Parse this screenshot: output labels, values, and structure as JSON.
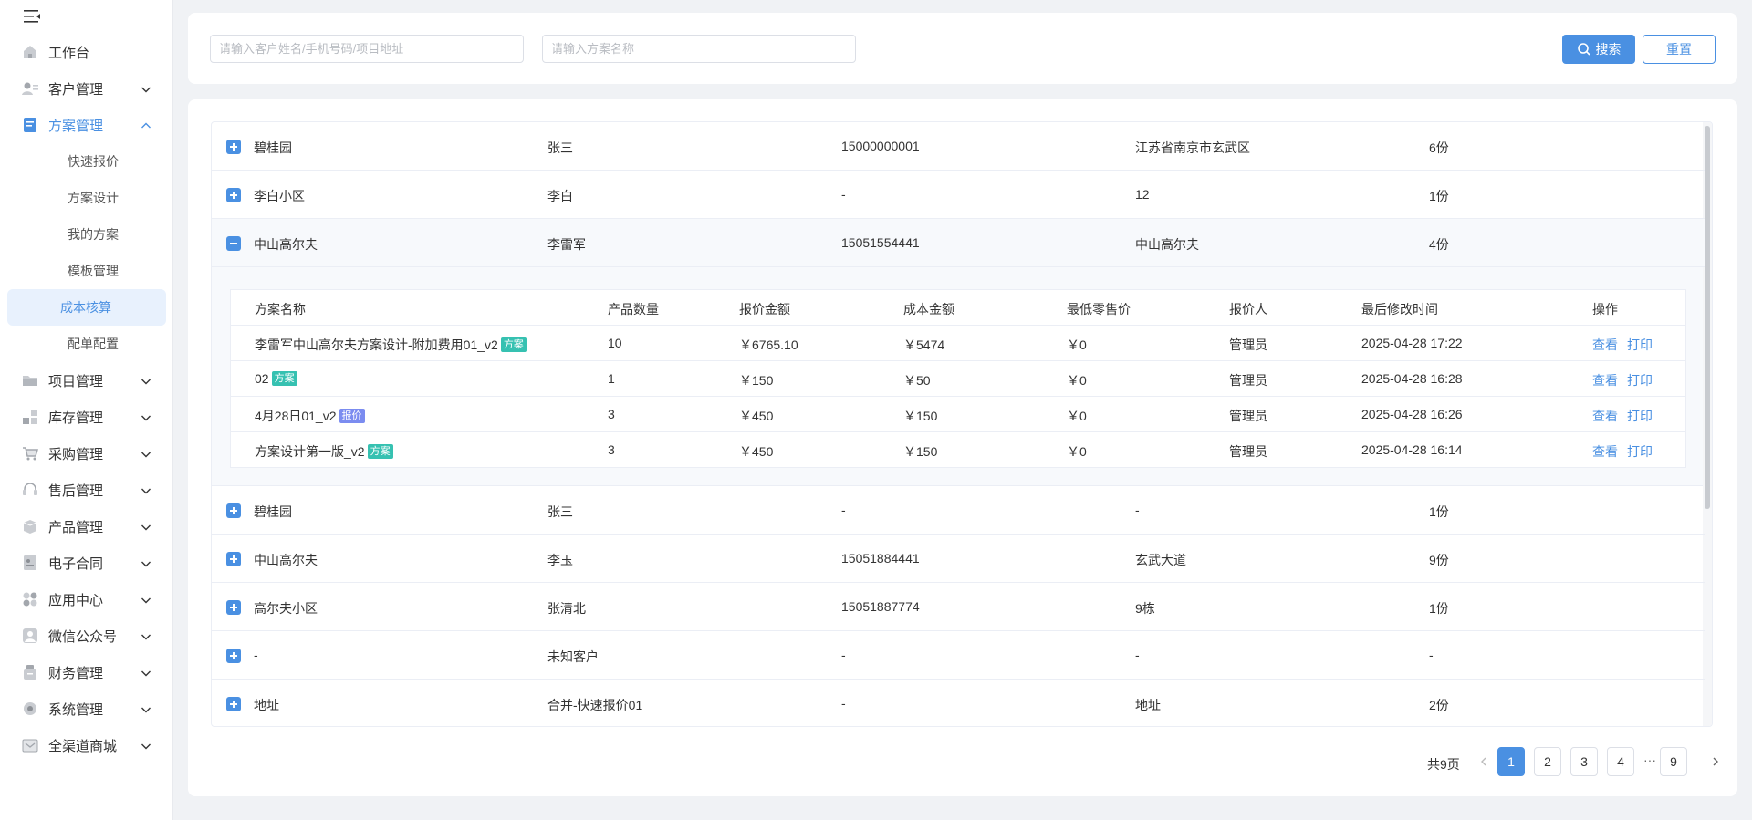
{
  "sidebar": {
    "items": [
      {
        "label": "工作台",
        "icon": "home-icon",
        "has_children": false
      },
      {
        "label": "客户管理",
        "icon": "customer-icon",
        "has_children": true
      },
      {
        "label": "方案管理",
        "icon": "plan-icon",
        "has_children": true,
        "expanded": true,
        "children": [
          "快速报价",
          "方案设计",
          "我的方案",
          "模板管理",
          "成本核算",
          "配单配置"
        ],
        "selected_child": "成本核算"
      },
      {
        "label": "项目管理",
        "icon": "folder-icon",
        "has_children": true
      },
      {
        "label": "库存管理",
        "icon": "inventory-icon",
        "has_children": true
      },
      {
        "label": "采购管理",
        "icon": "cart-icon",
        "has_children": true
      },
      {
        "label": "售后管理",
        "icon": "headset-icon",
        "has_children": true
      },
      {
        "label": "产品管理",
        "icon": "product-icon",
        "has_children": true
      },
      {
        "label": "电子合同",
        "icon": "contract-icon",
        "has_children": true
      },
      {
        "label": "应用中心",
        "icon": "apps-icon",
        "has_children": true
      },
      {
        "label": "微信公众号",
        "icon": "wechat-user-icon",
        "has_children": true
      },
      {
        "label": "财务管理",
        "icon": "finance-icon",
        "has_children": true
      },
      {
        "label": "系统管理",
        "icon": "settings-icon",
        "has_children": true
      },
      {
        "label": "全渠道商城",
        "icon": "mall-icon",
        "has_children": true
      }
    ]
  },
  "search": {
    "customer_placeholder": "请输入客户姓名/手机号码/项目地址",
    "plan_placeholder": "请输入方案名称",
    "search_label": "搜索",
    "reset_label": "重置"
  },
  "rows_top": [
    {
      "project": "碧桂园",
      "customer": "张三",
      "phone": "15000000001",
      "address": "江苏省南京市玄武区",
      "count": "6份"
    },
    {
      "project": "李白小区",
      "customer": "李白",
      "phone": "-",
      "address": "12",
      "count": "1份"
    },
    {
      "project": "中山高尔夫",
      "customer": "李雷军",
      "phone": "15051554441",
      "address": "中山高尔夫",
      "count": "4份"
    }
  ],
  "sub_table": {
    "headers": [
      "方案名称",
      "产品数量",
      "报价金额",
      "成本金额",
      "最低零售价",
      "报价人",
      "最后修改时间",
      "操作"
    ],
    "rows": [
      {
        "name": "李雷军中山高尔夫方案设计-附加费用01_v2",
        "tag": "方案",
        "qty": "10",
        "quote": "￥6765.10",
        "cost": "￥5474",
        "min_price": "￥0",
        "person": "管理员",
        "time": "2025-04-28 17:22"
      },
      {
        "name": "02",
        "tag": "方案",
        "qty": "1",
        "quote": "￥150",
        "cost": "￥50",
        "min_price": "￥0",
        "person": "管理员",
        "time": "2025-04-28 16:28"
      },
      {
        "name": "4月28日01_v2",
        "tag": "报价",
        "qty": "3",
        "quote": "￥450",
        "cost": "￥150",
        "min_price": "￥0",
        "person": "管理员",
        "time": "2025-04-28 16:26"
      },
      {
        "name": "方案设计第一版_v2",
        "tag": "方案",
        "qty": "3",
        "quote": "￥450",
        "cost": "￥150",
        "min_price": "￥0",
        "person": "管理员",
        "time": "2025-04-28 16:14"
      }
    ],
    "view_label": "查看",
    "print_label": "打印"
  },
  "rows_bottom": [
    {
      "project": "碧桂园",
      "customer": "张三",
      "phone": "-",
      "address": "-",
      "count": "1份"
    },
    {
      "project": "中山高尔夫",
      "customer": "李玉",
      "phone": "15051884441",
      "address": "玄武大道",
      "count": "9份"
    },
    {
      "project": "高尔夫小区",
      "customer": "张清北",
      "phone": "15051887774",
      "address": "9栋",
      "count": "1份"
    },
    {
      "project": "-",
      "customer": "未知客户",
      "phone": "-",
      "address": "-",
      "count": "-"
    },
    {
      "project": "地址",
      "customer": "合并-快速报价01",
      "phone": "-",
      "address": "地址",
      "count": "2份"
    }
  ],
  "pagination": {
    "total_label": "共9页",
    "pages": [
      "1",
      "2",
      "3",
      "4",
      "9"
    ],
    "current": "1",
    "ellipsis": "···"
  },
  "colors": {
    "primary": "#4a90e2",
    "tag_plan": "#36c1b1",
    "tag_quote": "#7b8cf0"
  }
}
